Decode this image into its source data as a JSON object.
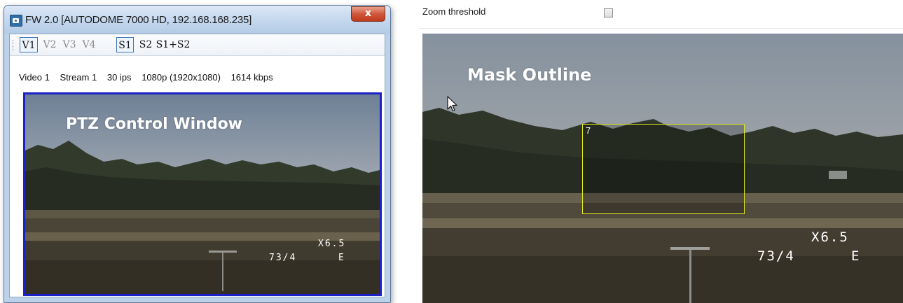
{
  "ptz_window": {
    "title": "FW 2.0 [AUTODOME 7000 HD, 192.168.168.235]",
    "close_symbol": "x",
    "toolbar": {
      "video_buttons": [
        "V1",
        "V2",
        "V3",
        "V4"
      ],
      "stream_buttons": [
        "S1",
        "S2",
        "S1+S2"
      ],
      "active_video": "V1",
      "active_stream": "S1"
    },
    "info": {
      "video": "Video 1",
      "stream": "Stream 1",
      "fps": "30 ips",
      "resolution": "1080p (1920x1080)",
      "bitrate": "1614 kbps"
    },
    "overlay_label": "PTZ Control Window",
    "osd": {
      "zoom": "X6.5",
      "position": "73/4",
      "direction": "E"
    }
  },
  "mask_view": {
    "zoom_threshold_label": "Zoom threshold",
    "zoom_threshold_checked": false,
    "overlay_label": "Mask Outline",
    "mask_number": "7",
    "mask_outline_color": "#e1e81d",
    "osd": {
      "zoom": "X6.5",
      "position": "73/4",
      "direction": "E"
    }
  },
  "colors": {
    "video_border": "#1a22c8",
    "close_button": "#c94a2e",
    "title_bar": "#c3d7ee"
  },
  "icons": [
    "camera-app-icon",
    "close-icon",
    "mouse-cursor-icon",
    "checkbox-icon"
  ]
}
